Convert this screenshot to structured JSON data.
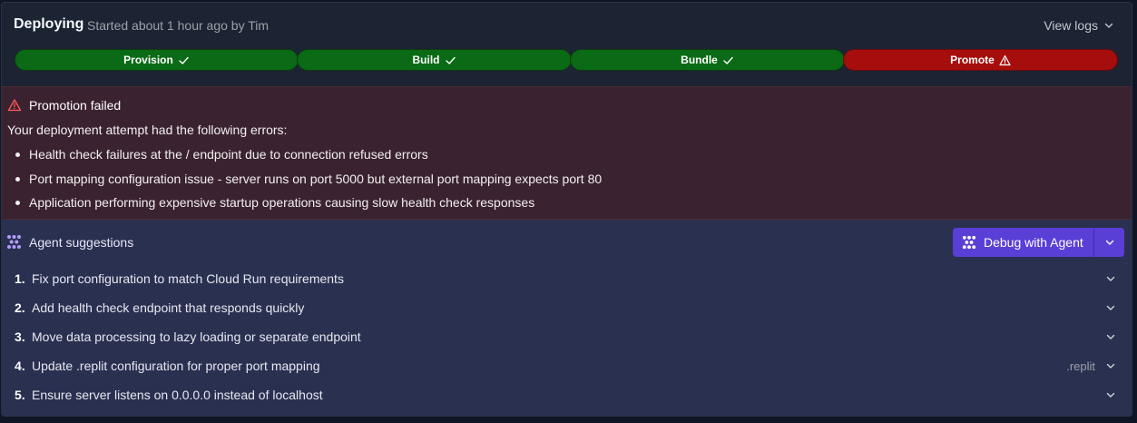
{
  "header": {
    "title": "Deploying",
    "subtitle": "Started about 1 hour ago by Tim",
    "view_logs": "View logs"
  },
  "stepper": {
    "steps": [
      {
        "label": "Provision",
        "status": "success",
        "icon": "check-icon"
      },
      {
        "label": "Build",
        "status": "success",
        "icon": "check-icon"
      },
      {
        "label": "Bundle",
        "status": "success",
        "icon": "check-icon"
      },
      {
        "label": "Promote",
        "status": "failed",
        "icon": "warning-icon"
      }
    ]
  },
  "error": {
    "title": "Promotion failed",
    "intro": "Your deployment attempt had the following errors:",
    "items": [
      "Health check failures at the / endpoint due to connection refused errors",
      "Port mapping configuration issue - server runs on port 5000 but external port mapping expects port 80",
      "Application performing expensive startup operations causing slow health check responses"
    ]
  },
  "agent": {
    "title": "Agent suggestions",
    "debug_label": "Debug with Agent",
    "suggestions": [
      {
        "num": "1.",
        "text": "Fix port configuration to match Cloud Run requirements",
        "file": ""
      },
      {
        "num": "2.",
        "text": "Add health check endpoint that responds quickly",
        "file": ""
      },
      {
        "num": "3.",
        "text": "Move data processing to lazy loading or separate endpoint",
        "file": ""
      },
      {
        "num": "4.",
        "text": "Update .replit configuration for proper port mapping",
        "file": ".replit"
      },
      {
        "num": "5.",
        "text": "Ensure server listens on 0.0.0.0 instead of localhost",
        "file": ""
      }
    ]
  },
  "colors": {
    "success": "#0a6a15",
    "failed": "#a60d0d",
    "accent": "#5a3fd6",
    "error_bg": "#3b2230",
    "agent_bg": "#2a3050"
  }
}
